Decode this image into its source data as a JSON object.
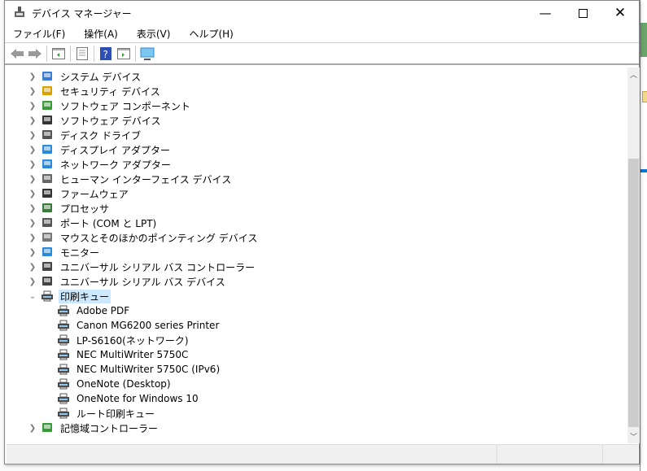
{
  "window": {
    "title": "デバイス マネージャー"
  },
  "menu": [
    "ファイル(F)",
    "操作(A)",
    "表示(V)",
    "ヘルプ(H)"
  ],
  "toolbar": [
    "back",
    "forward",
    "show-hide-console-tree",
    "properties",
    "help",
    "action-pane",
    "scan-hardware"
  ],
  "tree": {
    "categories": [
      {
        "label": "システム デバイス",
        "icon": "system-icon",
        "color": "#3a7bd5"
      },
      {
        "label": "セキュリティ デバイス",
        "icon": "security-key-icon",
        "color": "#d8a000"
      },
      {
        "label": "ソフトウェア コンポーネント",
        "icon": "software-component-icon",
        "color": "#3a9a3a"
      },
      {
        "label": "ソフトウェア デバイス",
        "icon": "software-device-icon",
        "color": "#333333"
      },
      {
        "label": "ディスク ドライブ",
        "icon": "disk-icon",
        "color": "#555555"
      },
      {
        "label": "ディスプレイ アダプター",
        "icon": "display-adapter-icon",
        "color": "#2b8ad8"
      },
      {
        "label": "ネットワーク アダプター",
        "icon": "network-adapter-icon",
        "color": "#2b8ad8"
      },
      {
        "label": "ヒューマン インターフェイス デバイス",
        "icon": "hid-icon",
        "color": "#666666"
      },
      {
        "label": "ファームウェア",
        "icon": "firmware-icon",
        "color": "#333333"
      },
      {
        "label": "プロセッサ",
        "icon": "processor-icon",
        "color": "#3a7a3a"
      },
      {
        "label": "ポート (COM と LPT)",
        "icon": "port-icon",
        "color": "#555555"
      },
      {
        "label": "マウスとそのほかのポインティング デバイス",
        "icon": "mouse-icon",
        "color": "#777777"
      },
      {
        "label": "モニター",
        "icon": "monitor-icon",
        "color": "#2b8ad8"
      },
      {
        "label": "ユニバーサル シリアル バス コントローラー",
        "icon": "usb-icon",
        "color": "#444444"
      },
      {
        "label": "ユニバーサル シリアル バス デバイス",
        "icon": "usb-icon",
        "color": "#444444"
      }
    ],
    "expanded": {
      "label": "印刷キュー",
      "icon": "printer-icon",
      "children": [
        "Adobe PDF",
        "Canon MG6200 series Printer",
        "LP-S6160(ネットワーク)",
        "NEC MultiWriter 5750C",
        "NEC MultiWriter 5750C (IPv6)",
        "OneNote (Desktop)",
        "OneNote for Windows 10",
        "ルート印刷キュー"
      ]
    },
    "after": [
      {
        "label": "記憶域コントローラー",
        "icon": "storage-controller-icon",
        "color": "#3a9a3a"
      }
    ]
  },
  "scrollbar": {
    "position_fraction": 0.28,
    "visible_fraction": 0.72
  }
}
